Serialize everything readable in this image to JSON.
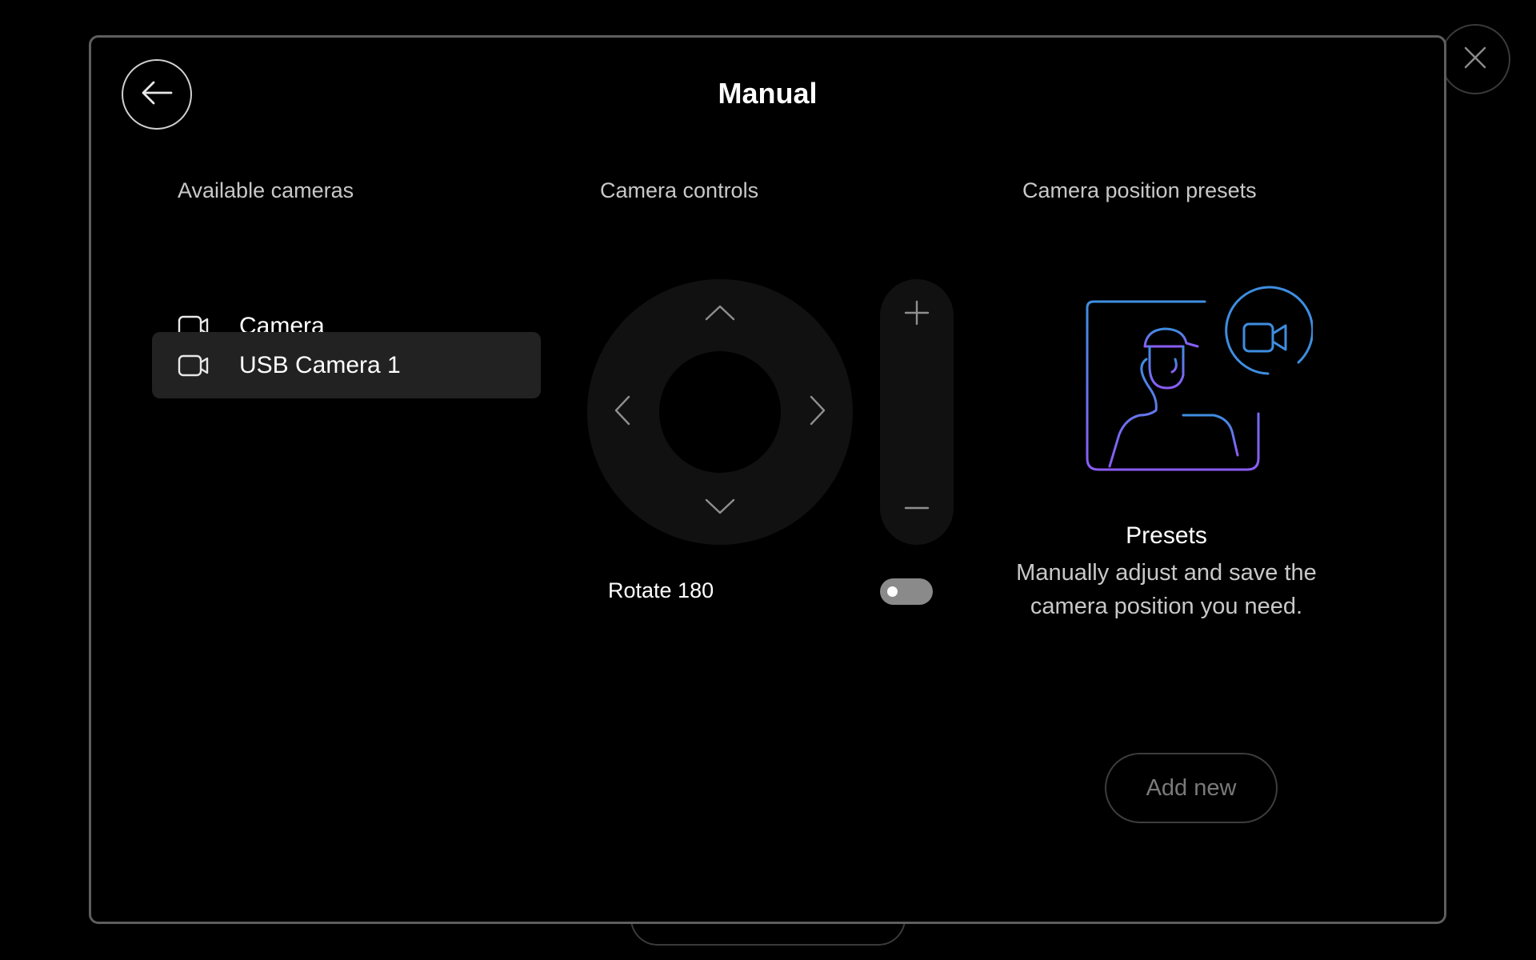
{
  "dialog": {
    "title": "Manual"
  },
  "columns": {
    "cameras_heading": "Available cameras",
    "controls_heading": "Camera controls",
    "presets_heading": "Camera position presets"
  },
  "cameras": [
    {
      "label": "Camera",
      "selected": false,
      "icon": "video-camera-icon"
    },
    {
      "label": "USB Camera 1",
      "selected": true,
      "icon": "video-camera-icon"
    }
  ],
  "controls": {
    "rotate_label": "Rotate 180",
    "rotate_on": false
  },
  "presets": {
    "title": "Presets",
    "description_line1": "Manually adjust and save the",
    "description_line2": "camera position you need.",
    "add_button": "Add new"
  },
  "colors": {
    "accent_blue": "#3e8ee0",
    "accent_purple": "#8b5cf6"
  }
}
